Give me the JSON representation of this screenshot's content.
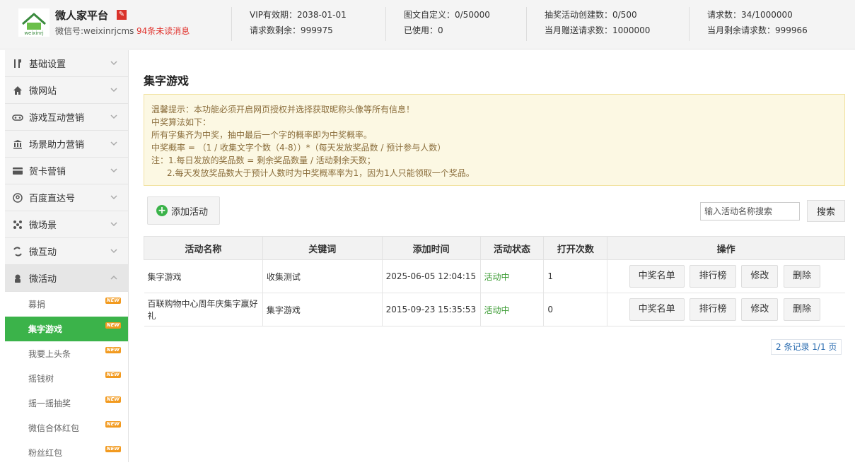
{
  "header": {
    "brand_title": "微人家平台",
    "logo_text": "weixinrj",
    "wechat_id": "微信号:weixinrjcms",
    "unread": "94条未读消息",
    "stats": [
      [
        "VIP有效期：2038-01-01",
        "请求数剩余：999975"
      ],
      [
        "图文自定义：0/50000",
        "已使用：0"
      ],
      [
        "抽奖活动创建数：0/500",
        "当月赠送请求数：1000000"
      ],
      [
        "请求数：34/1000000",
        "当月剩余请求数：999966"
      ]
    ]
  },
  "sidebar": {
    "items": [
      {
        "label": "基础设置",
        "icon": "tools-icon"
      },
      {
        "label": "微网站",
        "icon": "home-icon"
      },
      {
        "label": "游戏互动营销",
        "icon": "gamepad-icon"
      },
      {
        "label": "场景助力营销",
        "icon": "bank-icon"
      },
      {
        "label": "贺卡营销",
        "icon": "card-icon"
      },
      {
        "label": "百度直达号",
        "icon": "target-icon"
      },
      {
        "label": "微场景",
        "icon": "scene-icon"
      },
      {
        "label": "微互动",
        "icon": "interact-icon"
      },
      {
        "label": "微活动",
        "icon": "activity-icon"
      }
    ],
    "sub_items": [
      {
        "label": "募捐",
        "badge": "NEW"
      },
      {
        "label": "集字游戏",
        "badge": "NEW"
      },
      {
        "label": "我要上头条",
        "badge": "NEW"
      },
      {
        "label": "摇钱树",
        "badge": "NEW"
      },
      {
        "label": "摇一摇抽奖",
        "badge": "NEW"
      },
      {
        "label": "微信合体红包",
        "badge": "NEW"
      },
      {
        "label": "粉丝红包",
        "badge": "NEW"
      }
    ]
  },
  "main": {
    "title": "集字游戏",
    "notice": [
      "温馨提示：本功能必须开启网页授权并选择获取昵称头像等所有信息！",
      "中奖算法如下：",
      "所有字集齐为中奖，抽中最后一个字的概率即为中奖概率。",
      "中奖概率 = （1 / 收集文字个数（4-8））*（每天发放奖品数 / 预计参与人数）",
      "注：1.每日发放的奖品数 = 剩余奖品数量 / 活动剩余天数；",
      "2.每天发放奖品数大于预计人数时为中奖概率率为1，因为1人只能领取一个奖品。"
    ],
    "add_button": "添加活动",
    "search_placeholder": "输入活动名称搜索",
    "search_button": "搜索",
    "columns": [
      "活动名称",
      "关键词",
      "添加时间",
      "活动状态",
      "打开次数",
      "操作"
    ],
    "rows": [
      {
        "name": "集字游戏",
        "keyword": "收集测试",
        "time": "2025-06-05 12:04:15",
        "status": "活动中",
        "opens": "1"
      },
      {
        "name": "百联购物中心周年庆集字赢好礼",
        "keyword": "集字游戏",
        "time": "2015-09-23 15:35:53",
        "status": "活动中",
        "opens": "0"
      }
    ],
    "row_actions": [
      "中奖名单",
      "排行榜",
      "修改",
      "删除"
    ],
    "pager": "2 条记录 1/1 页"
  },
  "colors": {
    "accent": "#3bb34a",
    "notice_bg": "#fcf8e3",
    "notice_text": "#8a6d3b",
    "status": "#3a9b32",
    "unread": "#e0312b"
  }
}
